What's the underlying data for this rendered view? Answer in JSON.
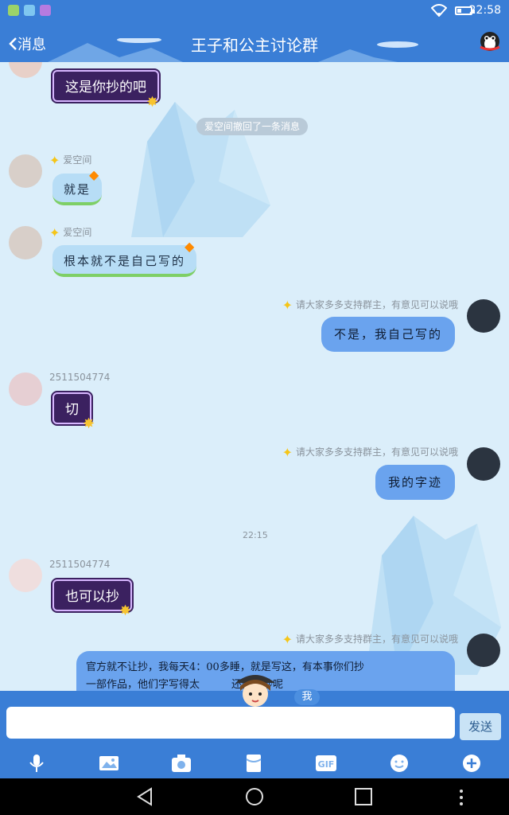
{
  "status_bar": {
    "time": "22:58"
  },
  "header": {
    "back_label": "消息",
    "title": "王子和公主讨论群"
  },
  "messages": {
    "m1": {
      "text": "这是你抄的吧"
    },
    "sys1": {
      "text": "爱空间撤回了一条消息"
    },
    "m2": {
      "sender": "爱空间",
      "text": "就是"
    },
    "m3": {
      "sender": "爱空间",
      "text": "根本就不是自己写的"
    },
    "m4": {
      "sender": "请大家多多支持群主，有意见可以说哦",
      "text": "不是，我自己写的"
    },
    "m5": {
      "sender": "2511504774",
      "text": "切"
    },
    "m6": {
      "sender": "请大家多多支持群主，有意见可以说哦",
      "text": "我的字迹"
    },
    "time1": {
      "text": "22:15"
    },
    "m7": {
      "sender": "2511504774",
      "text": "也可以抄"
    },
    "m8": {
      "sender": "请大家多多支持群主，有意见可以说哦",
      "line1": "官方就不让抄，我每天4：00多睡，就是写这，有本事你们抄",
      "line2": "一部作品，他们字写得太",
      "line2b": "还懒得抄呢"
    }
  },
  "input": {
    "placeholder": "",
    "value": "",
    "send_label": "发送",
    "me_label": "我"
  },
  "toolbar": [
    "microphone-icon",
    "picture-icon",
    "camera-icon",
    "red-packet-icon",
    "gif-icon",
    "emoji-icon",
    "plus-icon"
  ],
  "colors": {
    "theme_blue": "#3a7ed6",
    "chat_bg": "#dbeefa",
    "bubble_blue": "#6aa3ee",
    "bubble_purple": "#3b2160"
  }
}
